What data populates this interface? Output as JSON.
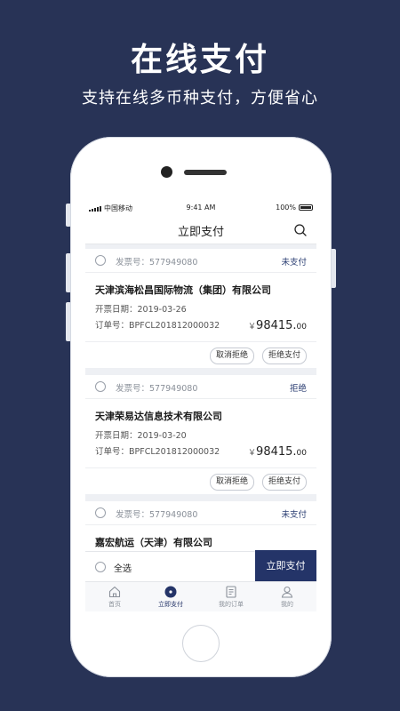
{
  "promo": {
    "title": "在线支付",
    "subtitle": "支持在线多币种支付，方便省心"
  },
  "statusbar": {
    "carrier": "中国移动",
    "time": "9:41 AM",
    "battery": "100%"
  },
  "navbar": {
    "title": "立即支付",
    "search_icon": "search-icon"
  },
  "cards": [
    {
      "invoice": "发票号：577949080",
      "status": "未支付",
      "company": "天津滨海松昌国际物流（集团）有限公司",
      "date": "开票日期：2019-03-26",
      "order": "订单号：BPFCL201812000032",
      "currency": "￥",
      "amount_int": "98415.",
      "amount_dec": "00",
      "cancel_label": "取消拒绝",
      "reject_label": "拒绝支付"
    },
    {
      "invoice": "发票号：577949080",
      "status": "拒绝",
      "company": "天津荣易达信息技术有限公司",
      "date": "开票日期：2019-03-20",
      "order": "订单号：BPFCL201812000032",
      "currency": "￥",
      "amount_int": "98415.",
      "amount_dec": "00",
      "cancel_label": "取消拒绝",
      "reject_label": "拒绝支付"
    },
    {
      "invoice": "发票号：577949080",
      "status": "未支付",
      "company": "嘉宏航运（天津）有限公司"
    }
  ],
  "bottom_bar": {
    "select_all": "全选",
    "pay_button": "立即支付"
  },
  "tabbar": {
    "items": [
      {
        "label": "首页",
        "icon": "home-icon"
      },
      {
        "label": "立即支付",
        "icon": "pay-icon"
      },
      {
        "label": "我的订单",
        "icon": "order-icon"
      },
      {
        "label": "我的",
        "icon": "user-icon"
      }
    ],
    "active_index": 1
  },
  "colors": {
    "background": "#283356",
    "accent": "#243468",
    "status_text": "#2c3f73"
  }
}
